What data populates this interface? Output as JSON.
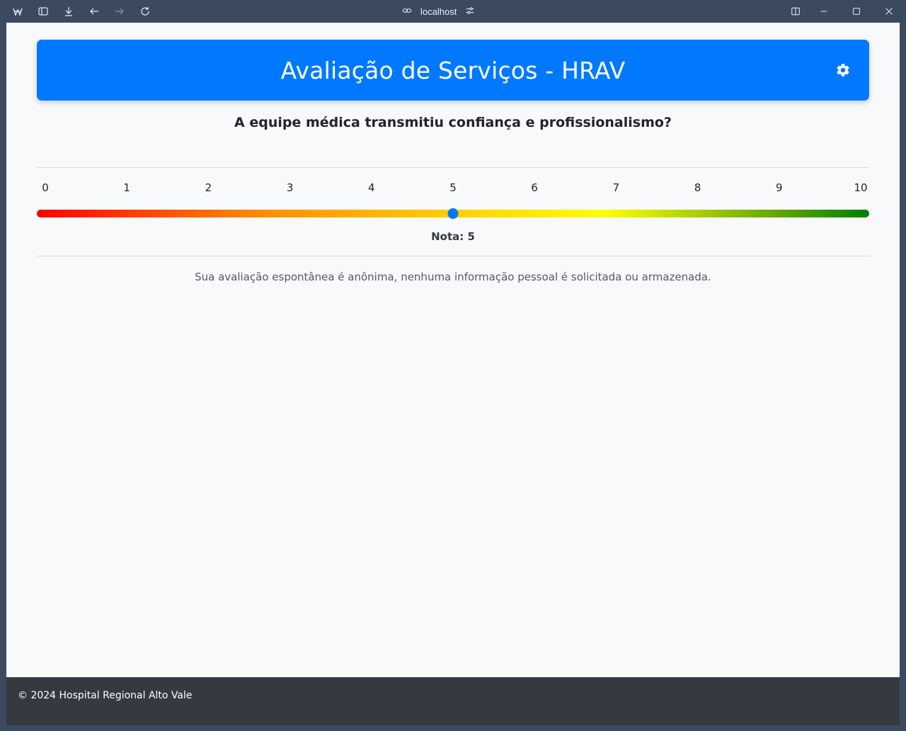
{
  "browser": {
    "url": "localhost"
  },
  "header": {
    "title": "Avaliação de Serviços - HRAV"
  },
  "survey": {
    "question": "A equipe médica transmitiu confiança e profissionalismo?",
    "scale": [
      "0",
      "1",
      "2",
      "3",
      "4",
      "5",
      "6",
      "7",
      "8",
      "9",
      "10"
    ],
    "min": 0,
    "max": 10,
    "value": 5,
    "score_label": "Nota: 5",
    "anonymity_note": "Sua avaliação espontânea é anônima, nenhuma informação pessoal é solicitada ou armazenada."
  },
  "footer": {
    "text": "© 2024 Hospital Regional Alto Vale"
  },
  "colors": {
    "primary": "#0079fe",
    "footer_bg": "#343a40",
    "page_bg": "#f8f9fa"
  }
}
